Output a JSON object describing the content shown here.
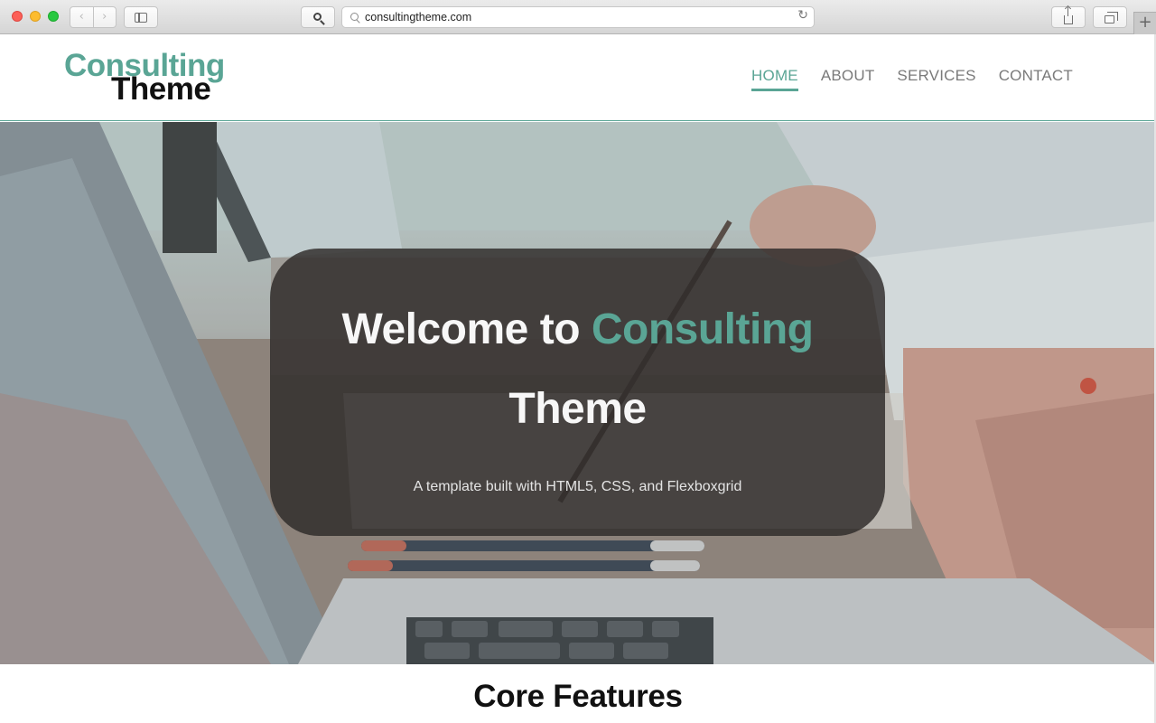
{
  "browser": {
    "url": "consultingtheme.com",
    "back_glyph": "‹",
    "forward_glyph": "›",
    "reload_glyph": "↻",
    "new_tab_glyph": "+"
  },
  "logo": {
    "line1": "Consulting",
    "line2": "Theme"
  },
  "nav": [
    {
      "label": "HOME",
      "active": true
    },
    {
      "label": "ABOUT",
      "active": false
    },
    {
      "label": "SERVICES",
      "active": false
    },
    {
      "label": "CONTACT",
      "active": false
    }
  ],
  "hero": {
    "title_prefix": "Welcome to ",
    "title_accent": "Consulting",
    "title_line2": "Theme",
    "subtitle": "A template built with HTML5, CSS, and Flexboxgrid"
  },
  "features": {
    "title": "Core Features"
  },
  "colors": {
    "accent": "#5aa595",
    "nav_text": "#7a7a7a",
    "hero_overlay": "rgba(45,41,40,0.82)"
  },
  "icons": [
    "search-icon",
    "sidebar-icon",
    "reload-icon",
    "share-icon",
    "tabs-icon",
    "new-tab-icon",
    "back-icon",
    "forward-icon"
  ]
}
